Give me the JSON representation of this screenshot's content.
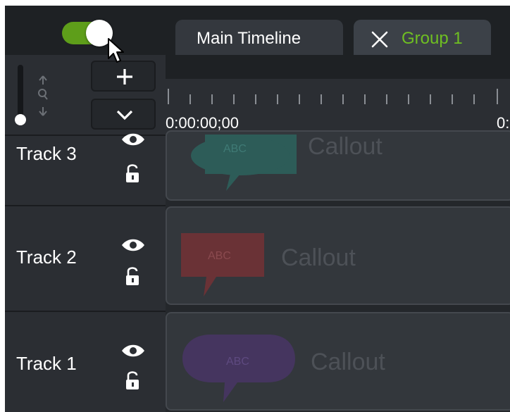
{
  "toggle": {
    "state": "on",
    "color": "#5e9e1a"
  },
  "tabs": [
    {
      "label": "Main Timeline"
    },
    {
      "label": "Group 1",
      "color": "#6fbf22"
    }
  ],
  "ruler": {
    "start_time": "0:00:00;00",
    "next_time_partial": "0:"
  },
  "tracks": [
    {
      "name": "Track 3",
      "clip_label": "Callout",
      "bubble_text": "ABC",
      "bubble_color": "#2d5c58"
    },
    {
      "name": "Track 2",
      "clip_label": "Callout",
      "bubble_text": "ABC",
      "bubble_color": "#6a3236"
    },
    {
      "name": "Track 1",
      "clip_label": "Callout",
      "bubble_text": "ABC",
      "bubble_color": "#45355f"
    }
  ]
}
